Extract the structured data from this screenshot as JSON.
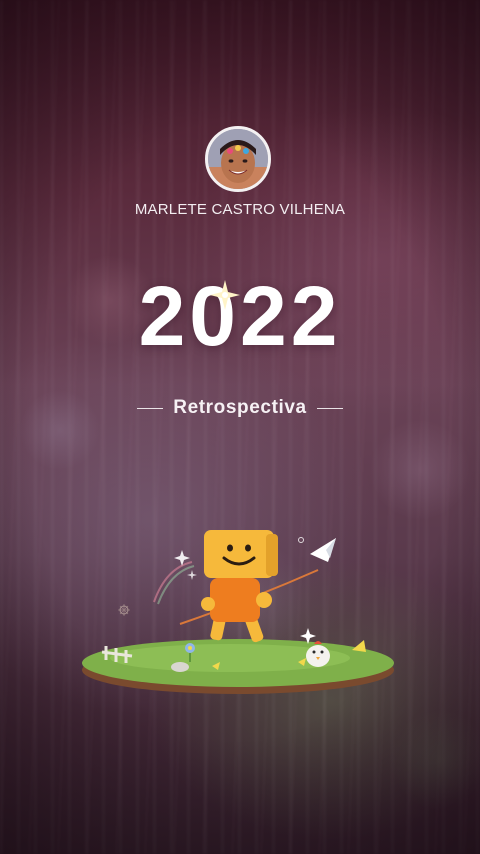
{
  "profile": {
    "username": "MARLETE CASTRO VILHENA",
    "avatar_icon": "profile-photo"
  },
  "headline": {
    "year": "2022",
    "subtitle": "Retrospectiva"
  },
  "illustration": {
    "mascot_icon": "smiling-box-mascot",
    "decor_icons": [
      "sparkle-icon",
      "paper-plane-icon",
      "chicken-icon",
      "flower-icon"
    ]
  },
  "colors": {
    "background_top": "#3d1624",
    "background_mid": "#6a4256",
    "text": "#ffffff",
    "mascot_yellow": "#f6b93b",
    "mascot_orange": "#ee7d1f",
    "grass": "#7fb04a"
  }
}
